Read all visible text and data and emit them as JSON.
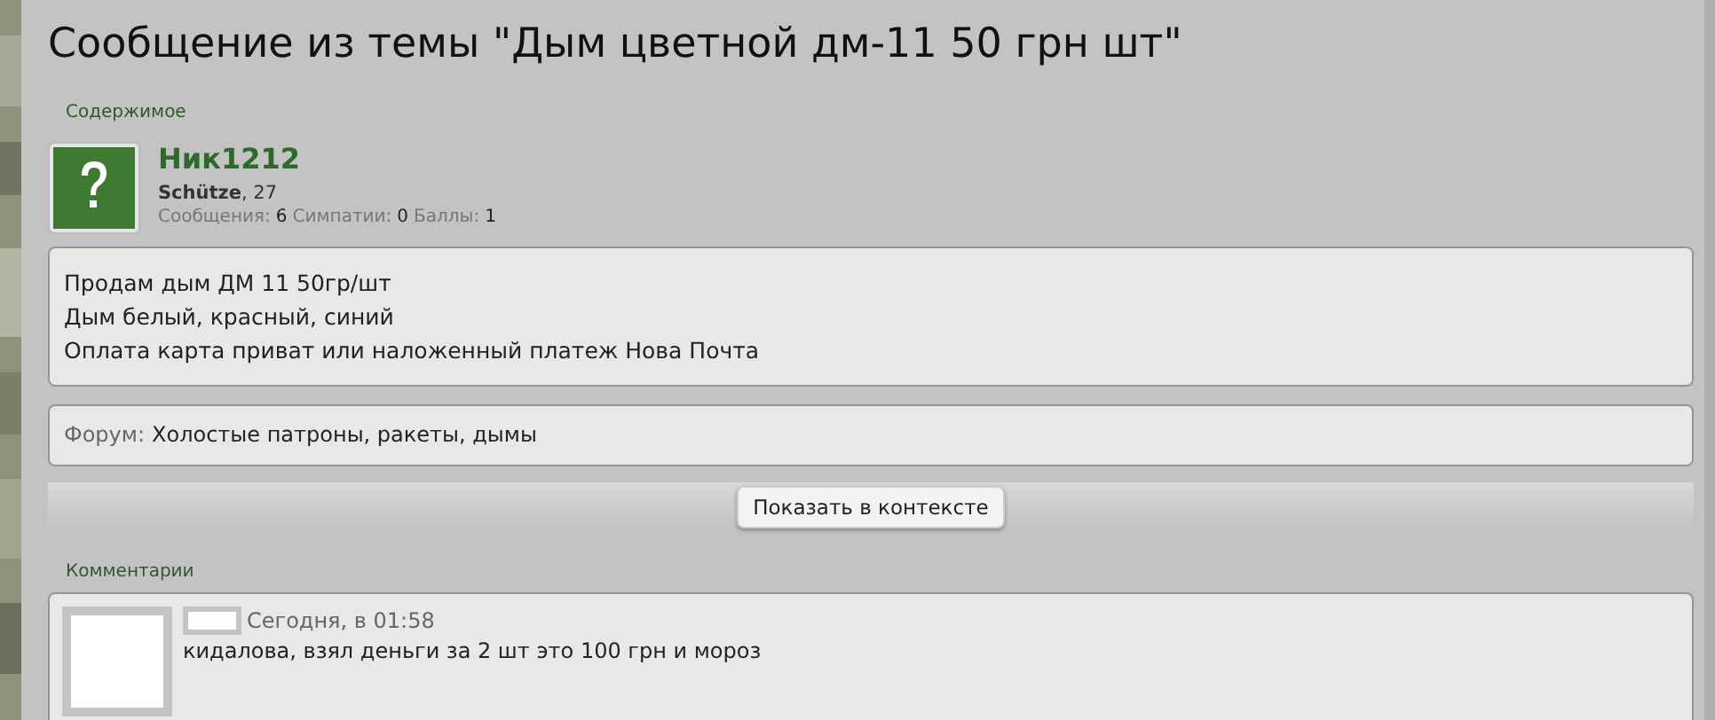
{
  "title": "Сообщение из темы \"Дым цветной дм-11 50 грн шт\"",
  "section_label": "Содержимое",
  "user": {
    "name": "Ник1212",
    "rank": "**Schütze**, 27",
    "stats": [
      {
        "label": "Сообщения:",
        "value": "6"
      },
      {
        "label": "Симпатии:",
        "value": "0"
      },
      {
        "label": "Баллы:",
        "value": "1"
      }
    ]
  },
  "message_lines": [
    "Продам дым ДМ 11 50гр/шт",
    "Дым белый, красный, синий",
    "Оплата карта приват или наложенный платеж Нова Почта"
  ],
  "forum": {
    "label": "Форум:",
    "value": "Холостые патроны, ракеты, дымы"
  },
  "context_button": "Показать в контексте",
  "comments_label": "Комментарии",
  "comments": [
    {
      "time": "Сегодня, в 01:58",
      "text": "кидалова, взял деньги за 2 шт это 100 грн и мороз"
    }
  ]
}
